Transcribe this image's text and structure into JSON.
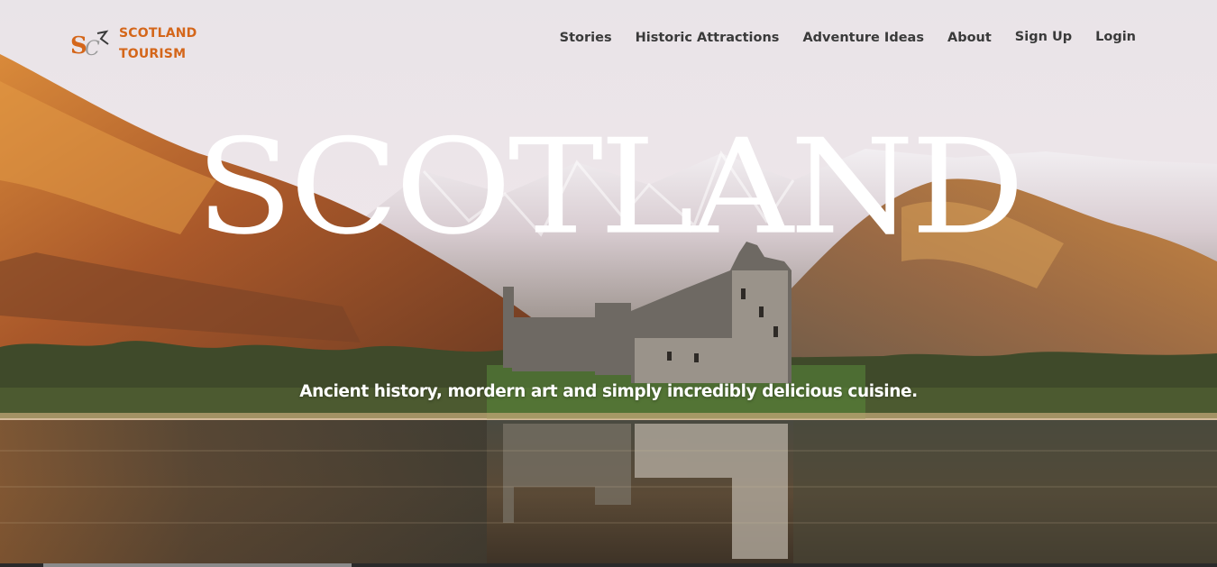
{
  "brand": {
    "logo_monogram": "SCA",
    "name_line1": "SCOTLAND",
    "name_line2": "TOURISM",
    "accent_color": "#d4661a"
  },
  "nav": {
    "items": [
      {
        "label": "Stories"
      },
      {
        "label": "Historic Attractions"
      },
      {
        "label": "Adventure Ideas"
      },
      {
        "label": "About"
      }
    ],
    "sign_up_label": "Sign Up",
    "login_label": "Login"
  },
  "hero": {
    "title": "SCOTLAND",
    "tagline": "Ancient history, mordern art and simply incredibly delicious cuisine.",
    "image_alt": "castle-by-loch-in-highlands"
  }
}
